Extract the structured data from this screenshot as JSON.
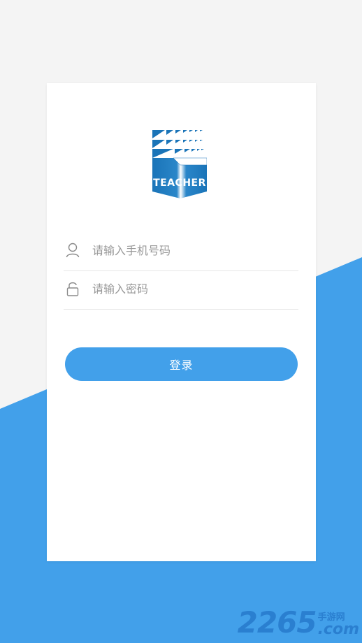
{
  "logo": {
    "text": "TEACHER",
    "icon": "teacher-logo"
  },
  "phone_field": {
    "placeholder": "请输入手机号码",
    "value": "",
    "icon": "user-icon"
  },
  "password_field": {
    "placeholder": "请输入密码",
    "value": "",
    "icon": "lock-icon"
  },
  "login_button": {
    "label": "登录"
  },
  "watermark": {
    "number": "2265",
    "top": "手游网",
    "bottom": ".com"
  },
  "colors": {
    "accent": "#42a0ea",
    "background": "#f4f4f4",
    "card": "#ffffff",
    "logo_blue": "#1a74b8"
  }
}
